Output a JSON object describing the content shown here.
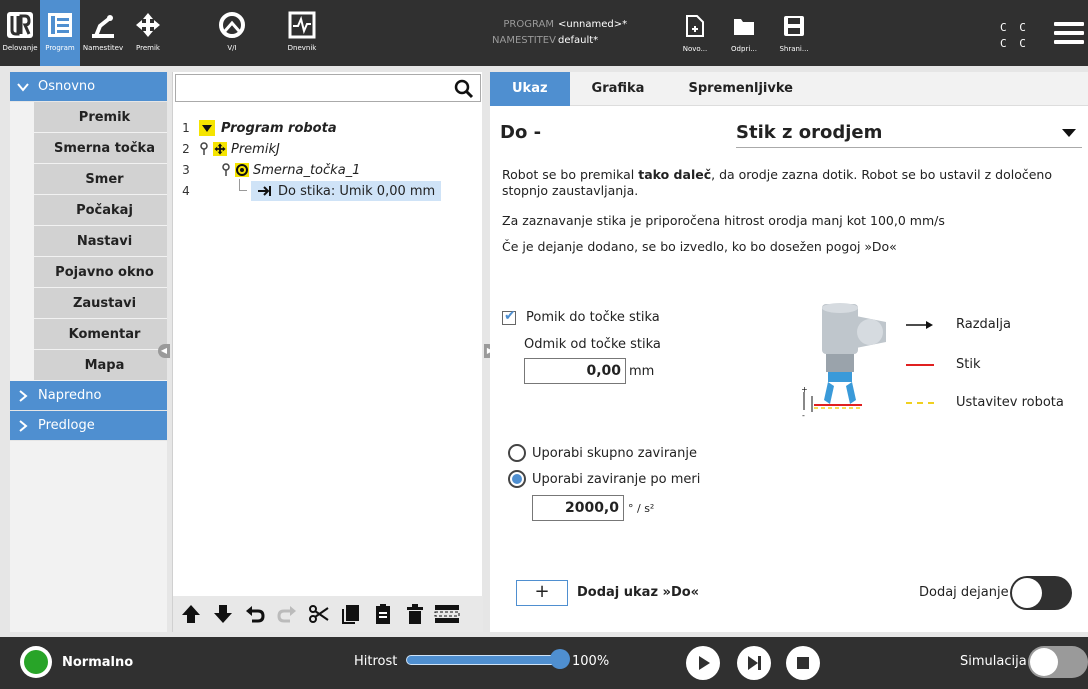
{
  "nav": {
    "items": [
      {
        "label": "Delovanje",
        "icon": "ur-logo-icon"
      },
      {
        "label": "Program",
        "icon": "program-tree-icon"
      },
      {
        "label": "Namestitev",
        "icon": "robot-arm-icon"
      },
      {
        "label": "Premik",
        "icon": "move-arrows-icon"
      },
      {
        "label": "V/I",
        "icon": "io-icon"
      },
      {
        "label": "Dnevnik",
        "icon": "log-icon"
      }
    ],
    "active": "Program"
  },
  "program_info": {
    "program_key": "PROGRAM",
    "program_value": "<unnamed>*",
    "install_key": "NAMESTITEV",
    "install_value": "default*"
  },
  "file_buttons": [
    {
      "label": "Novo...",
      "icon": "new-file-icon"
    },
    {
      "label": "Odpri...",
      "icon": "folder-icon"
    },
    {
      "label": "Shrani...",
      "icon": "save-icon"
    }
  ],
  "cc_text": [
    "C C",
    "C C"
  ],
  "sidebar": {
    "categories": [
      {
        "label": "Osnovno",
        "expanded": true
      },
      {
        "label": "Napredno",
        "expanded": false
      },
      {
        "label": "Predloge",
        "expanded": false
      }
    ],
    "items": [
      "Premik",
      "Smerna točka",
      "Smer",
      "Počakaj",
      "Nastavi",
      "Pojavno okno",
      "Zaustavi",
      "Komentar",
      "Mapa"
    ]
  },
  "tree": {
    "rows": [
      {
        "num": "1",
        "label": "Program robota",
        "style": "bold-italic"
      },
      {
        "num": "2",
        "label": "PremikJ",
        "style": "italic"
      },
      {
        "num": "3",
        "label": "Smerna_točka_1",
        "style": "italic"
      },
      {
        "num": "4",
        "label": "Do stika: Umik 0,00 mm",
        "style": "normal",
        "selected": true
      }
    ]
  },
  "tabs": [
    "Ukaz",
    "Grafika",
    "Spremenljivke"
  ],
  "command": {
    "title": "Do -",
    "select_value": "Stik z orodjem",
    "desc1_a": "Robot se bo premikal ",
    "desc1_bold": "tako daleč",
    "desc1_b": ", da orodje zazna dotik. Robot se bo ustavil z določeno stopnjo zaustavljanja.",
    "desc2": "Za zaznavanje stika je priporočena hitrost orodja manj kot 100,0 mm/s",
    "desc3": "Če je dejanje dodano, se bo izvedlo, ko bo dosežen pogoj »Do«",
    "checkbox_label": "Pomik do točke stika",
    "offset_label": "Odmik od točke stika",
    "offset_value": "0,00",
    "offset_unit": "mm",
    "radio1": "Uporabi skupno zaviranje",
    "radio2": "Uporabi zaviranje po meri",
    "decel_value": "2000,0",
    "decel_unit": "° / s²",
    "add_label": "Dodaj ukaz »Do«",
    "add_symbol": "+",
    "action_label": "Dodaj dejanje"
  },
  "legend": [
    {
      "label": "Razdalja",
      "color": "#111111"
    },
    {
      "label": "Stik",
      "color": "#e02020"
    },
    {
      "label": "Ustavitev robota",
      "color": "#f0d020"
    }
  ],
  "bottom": {
    "status": "Normalno",
    "speed_label": "Hitrost",
    "speed_value": "100%",
    "simulation_label": "Simulacija"
  },
  "colors": {
    "accent": "#4f8fd0",
    "bar": "#303030",
    "status_ok": "#28a428"
  }
}
